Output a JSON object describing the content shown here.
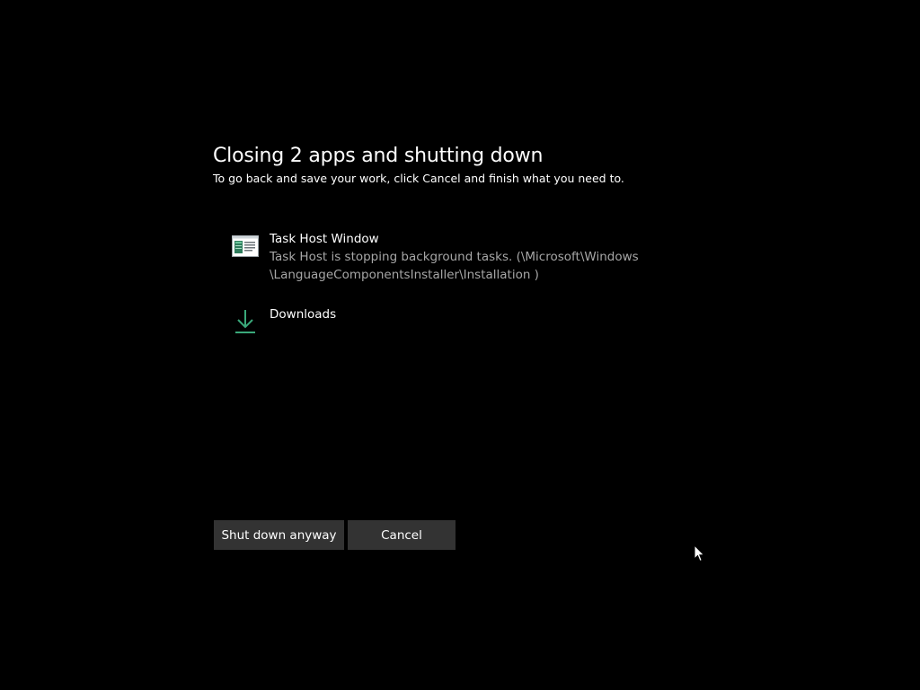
{
  "dialog": {
    "title": "Closing 2 apps and shutting down",
    "subtitle": "To go back and save your work, click Cancel and finish what you need to."
  },
  "apps": [
    {
      "name": "Task Host Window",
      "description_line1": "Task Host is stopping background tasks. (\\Microsoft\\Windows",
      "description_line2": "\\LanguageComponentsInstaller\\Installation )",
      "icon": "task-host-window-icon"
    },
    {
      "name": "Downloads",
      "icon": "download-arrow-icon"
    }
  ],
  "buttons": {
    "shutdown_label": "Shut down anyway",
    "cancel_label": "Cancel"
  },
  "colors": {
    "background": "#000000",
    "text": "#ffffff",
    "secondary_text": "#a6a6a6",
    "button_bg": "#333333",
    "accent": "#3aa87a"
  }
}
